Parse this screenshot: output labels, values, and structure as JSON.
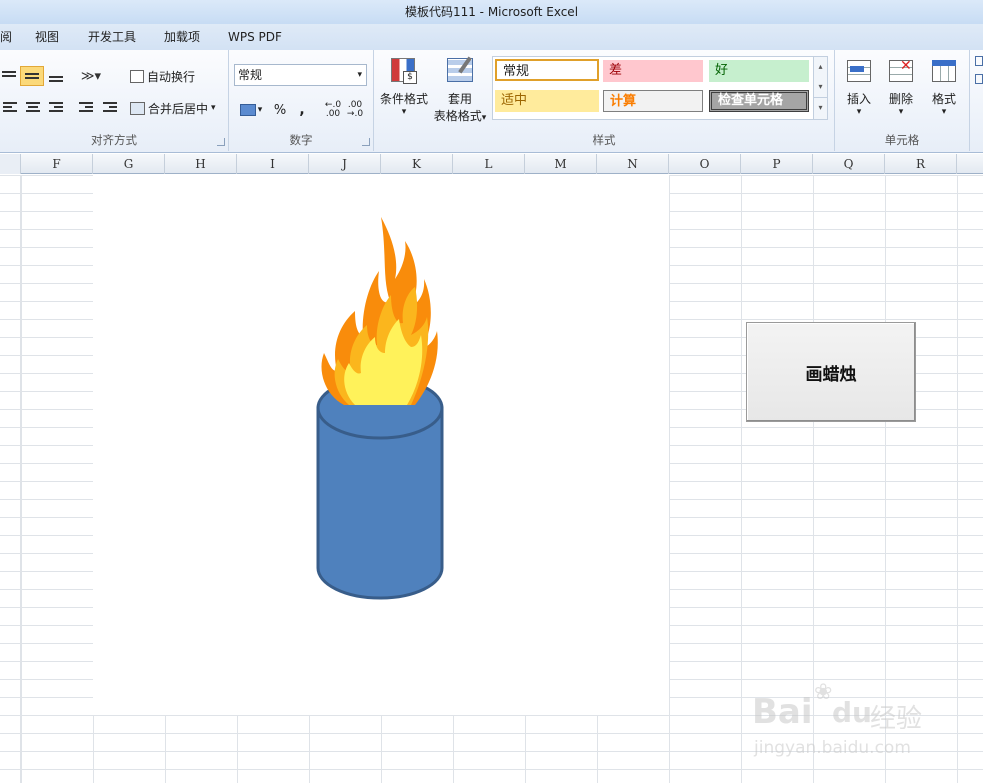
{
  "window": {
    "title": "模板代码111 - Microsoft Excel"
  },
  "tabs": [
    "阅",
    "视图",
    "开发工具",
    "加载项",
    "WPS PDF"
  ],
  "ribbon": {
    "alignment": {
      "label": "对齐方式",
      "wrap_text": "自动换行",
      "merge_center": "合并后居中"
    },
    "number": {
      "label": "数字",
      "format_value": "常规",
      "percent": "%",
      "comma": ","
    },
    "styles": {
      "label": "样式",
      "conditional_format_line1": "条件格式",
      "table_format_line1": "套用",
      "table_format_line2": "表格格式",
      "cell_styles": [
        {
          "name": "常规",
          "bg": "#ffffff",
          "fg": "#000000",
          "border": "#e0a02a"
        },
        {
          "name": "差",
          "bg": "#ffc7ce",
          "fg": "#9c0006",
          "border": "#ffc7ce"
        },
        {
          "name": "好",
          "bg": "#c6efce",
          "fg": "#006100",
          "border": "#c6efce"
        },
        {
          "name": "适中",
          "bg": "#ffeb9c",
          "fg": "#9c6500",
          "border": "#ffeb9c"
        },
        {
          "name": "计算",
          "bg": "#f2f2f2",
          "fg": "#fa7d00",
          "border": "#7f7f7f"
        },
        {
          "name": "检查单元格",
          "bg": "#a5a5a5",
          "fg": "#ffffff",
          "border": "#3f3f3f"
        }
      ]
    },
    "cells": {
      "label": "单元格",
      "insert": "插入",
      "delete": "删除",
      "format": "格式"
    }
  },
  "columns": [
    "F",
    "G",
    "H",
    "I",
    "J",
    "K",
    "L",
    "M",
    "N",
    "O",
    "P",
    "Q",
    "R"
  ],
  "macro_button": {
    "label": "画蜡烛"
  },
  "drawing": {
    "candle_color": "#4f81bd",
    "candle_outline": "#385d8a",
    "flame_outer": "#f98c0b",
    "flame_mid": "#fbb61d",
    "flame_inner": "#fff25a"
  },
  "watermark": {
    "brand": "Bai",
    "brand2": "du",
    "site": "经验",
    "url": "jingyan.baidu.com"
  }
}
